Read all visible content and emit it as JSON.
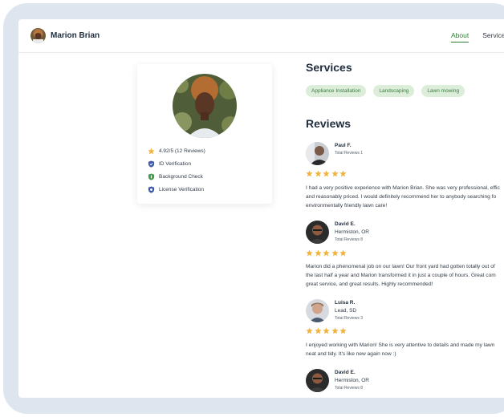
{
  "header": {
    "name": "Marion Brian",
    "nav": [
      {
        "label": "About",
        "active": true
      },
      {
        "label": "Services",
        "active": false
      }
    ]
  },
  "profile": {
    "rating": "4.92/5 (12 Reviews)",
    "checks": [
      {
        "label": "ID Verification",
        "icon": "shield-check-icon",
        "color": "#3f5aa8"
      },
      {
        "label": "Background Check",
        "icon": "shield-badge-icon",
        "color": "#3f9d4a"
      },
      {
        "label": "License Verification",
        "icon": "shield-star-icon",
        "color": "#3f5aa8"
      }
    ]
  },
  "services": {
    "title": "Services",
    "items": [
      "Appliance Installation",
      "Landscaping",
      "Lawn mowing"
    ]
  },
  "reviews": {
    "title": "Reviews",
    "items": [
      {
        "name": "Paul F.",
        "location": "",
        "total": "Total Reviews 1",
        "stars": 5,
        "lines": [
          "I had a very positive experience with Marion Brian. She was very professional, effic",
          "and reasonably priced. I would definitely recommend her to anybody searching fo",
          "environmentally friendly lawn care!"
        ]
      },
      {
        "name": "David E.",
        "location": "Hermiston, OR",
        "total": "Total Reviews 8",
        "stars": 5,
        "lines": [
          "Marion did a phenomenal job on our lawn! Our front yard had gotten totally out of",
          "the last half a year and Marion transformed it in just a couple of hours. Great com",
          "great service, and great results. Highly recommended!"
        ]
      },
      {
        "name": "Luisa R.",
        "location": "Lead, SD",
        "total": "Total Reviews 3",
        "stars": 5,
        "lines": [
          "I enjoyed working with Marion! She is very attentive to details and made my lawn",
          "neat and tidy. It's like new again now :)"
        ]
      },
      {
        "name": "David E.",
        "location": "Hermiston, OR",
        "total": "Total Reviews 8",
        "stars": 0,
        "lines": []
      }
    ]
  },
  "colors": {
    "accent": "#2f7d32",
    "chip_bg": "#dcedda",
    "star": "#f2b33d",
    "frame": "#dfe5ee"
  }
}
